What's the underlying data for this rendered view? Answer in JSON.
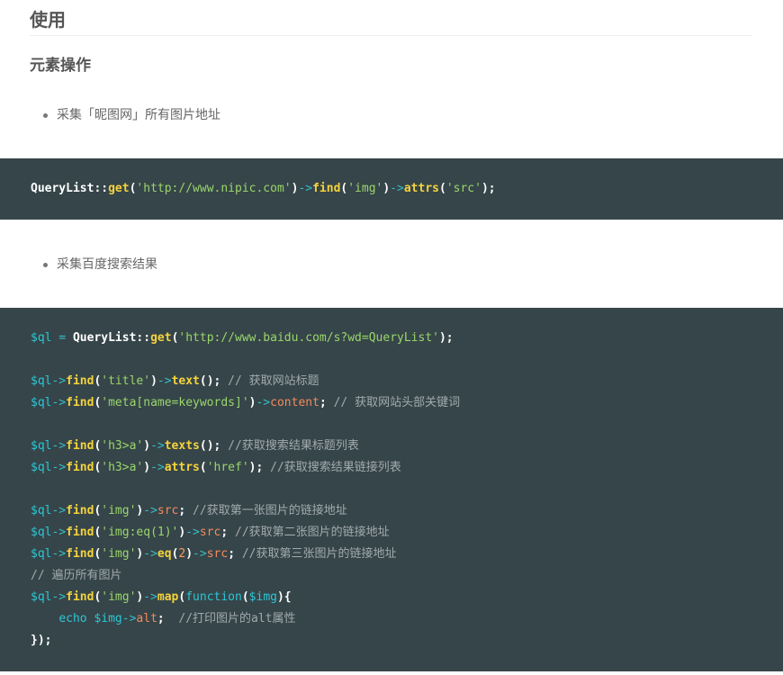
{
  "heading": "使用",
  "subheading": "元素操作",
  "bullets": [
    "采集「昵图网」所有图片地址",
    "采集百度搜索结果"
  ],
  "code1": [
    [
      [
        "cls",
        "QueryList"
      ],
      [
        "pun",
        "::"
      ],
      [
        "fn",
        "get"
      ],
      [
        "pun",
        "("
      ],
      [
        "str",
        "'http://www.nipic.com'"
      ],
      [
        "pun",
        ")"
      ],
      [
        "op",
        "->"
      ],
      [
        "fn",
        "find"
      ],
      [
        "pun",
        "("
      ],
      [
        "str",
        "'img'"
      ],
      [
        "pun",
        ")"
      ],
      [
        "op",
        "->"
      ],
      [
        "fn",
        "attrs"
      ],
      [
        "pun",
        "("
      ],
      [
        "str",
        "'src'"
      ],
      [
        "pun",
        ");"
      ]
    ]
  ],
  "code2": [
    [
      [
        "var",
        "$ql"
      ],
      [
        "pun",
        " "
      ],
      [
        "op",
        "="
      ],
      [
        "pun",
        " "
      ],
      [
        "cls",
        "QueryList"
      ],
      [
        "pun",
        "::"
      ],
      [
        "fn",
        "get"
      ],
      [
        "pun",
        "("
      ],
      [
        "str",
        "'http://www.baidu.com/s?wd=QueryList'"
      ],
      [
        "pun",
        ");"
      ]
    ],
    [],
    [
      [
        "var",
        "$ql"
      ],
      [
        "op",
        "->"
      ],
      [
        "fn",
        "find"
      ],
      [
        "pun",
        "("
      ],
      [
        "str",
        "'title'"
      ],
      [
        "pun",
        ")"
      ],
      [
        "op",
        "->"
      ],
      [
        "fn",
        "text"
      ],
      [
        "pun",
        "();"
      ],
      [
        "cmt",
        " // 获取网站标题"
      ]
    ],
    [
      [
        "var",
        "$ql"
      ],
      [
        "op",
        "->"
      ],
      [
        "fn",
        "find"
      ],
      [
        "pun",
        "("
      ],
      [
        "str",
        "'meta[name=keywords]'"
      ],
      [
        "pun",
        ")"
      ],
      [
        "op",
        "->"
      ],
      [
        "prop",
        "content"
      ],
      [
        "pun",
        ";"
      ],
      [
        "cmt",
        " // 获取网站头部关键词"
      ]
    ],
    [],
    [
      [
        "var",
        "$ql"
      ],
      [
        "op",
        "->"
      ],
      [
        "fn",
        "find"
      ],
      [
        "pun",
        "("
      ],
      [
        "str",
        "'h3>a'"
      ],
      [
        "pun",
        ")"
      ],
      [
        "op",
        "->"
      ],
      [
        "fn",
        "texts"
      ],
      [
        "pun",
        "();"
      ],
      [
        "cmt",
        " //获取搜索结果标题列表"
      ]
    ],
    [
      [
        "var",
        "$ql"
      ],
      [
        "op",
        "->"
      ],
      [
        "fn",
        "find"
      ],
      [
        "pun",
        "("
      ],
      [
        "str",
        "'h3>a'"
      ],
      [
        "pun",
        ")"
      ],
      [
        "op",
        "->"
      ],
      [
        "fn",
        "attrs"
      ],
      [
        "pun",
        "("
      ],
      [
        "str",
        "'href'"
      ],
      [
        "pun",
        ");"
      ],
      [
        "cmt",
        " //获取搜索结果链接列表"
      ]
    ],
    [],
    [
      [
        "var",
        "$ql"
      ],
      [
        "op",
        "->"
      ],
      [
        "fn",
        "find"
      ],
      [
        "pun",
        "("
      ],
      [
        "str",
        "'img'"
      ],
      [
        "pun",
        ")"
      ],
      [
        "op",
        "->"
      ],
      [
        "prop",
        "src"
      ],
      [
        "pun",
        ";"
      ],
      [
        "cmt",
        " //获取第一张图片的链接地址"
      ]
    ],
    [
      [
        "var",
        "$ql"
      ],
      [
        "op",
        "->"
      ],
      [
        "fn",
        "find"
      ],
      [
        "pun",
        "("
      ],
      [
        "str",
        "'img:eq(1)'"
      ],
      [
        "pun",
        ")"
      ],
      [
        "op",
        "->"
      ],
      [
        "prop",
        "src"
      ],
      [
        "pun",
        ";"
      ],
      [
        "cmt",
        " //获取第二张图片的链接地址"
      ]
    ],
    [
      [
        "var",
        "$ql"
      ],
      [
        "op",
        "->"
      ],
      [
        "fn",
        "find"
      ],
      [
        "pun",
        "("
      ],
      [
        "str",
        "'img'"
      ],
      [
        "pun",
        ")"
      ],
      [
        "op",
        "->"
      ],
      [
        "fn",
        "eq"
      ],
      [
        "pun",
        "("
      ],
      [
        "num",
        "2"
      ],
      [
        "pun",
        ")"
      ],
      [
        "op",
        "->"
      ],
      [
        "prop",
        "src"
      ],
      [
        "pun",
        ";"
      ],
      [
        "cmt",
        " //获取第三张图片的链接地址"
      ]
    ],
    [
      [
        "cmt",
        "// 遍历所有图片"
      ]
    ],
    [
      [
        "var",
        "$ql"
      ],
      [
        "op",
        "->"
      ],
      [
        "fn",
        "find"
      ],
      [
        "pun",
        "("
      ],
      [
        "str",
        "'img'"
      ],
      [
        "pun",
        ")"
      ],
      [
        "op",
        "->"
      ],
      [
        "fn",
        "map"
      ],
      [
        "pun",
        "("
      ],
      [
        "kw",
        "function"
      ],
      [
        "pun",
        "("
      ],
      [
        "var",
        "$img"
      ],
      [
        "pun",
        "){"
      ]
    ],
    [
      [
        "pun",
        "    "
      ],
      [
        "kw",
        "echo"
      ],
      [
        "pun",
        " "
      ],
      [
        "var",
        "$img"
      ],
      [
        "op",
        "->"
      ],
      [
        "prop",
        "alt"
      ],
      [
        "pun",
        ";"
      ],
      [
        "cmt",
        "  //打印图片的alt属性"
      ]
    ],
    [
      [
        "pun",
        "});"
      ]
    ]
  ]
}
